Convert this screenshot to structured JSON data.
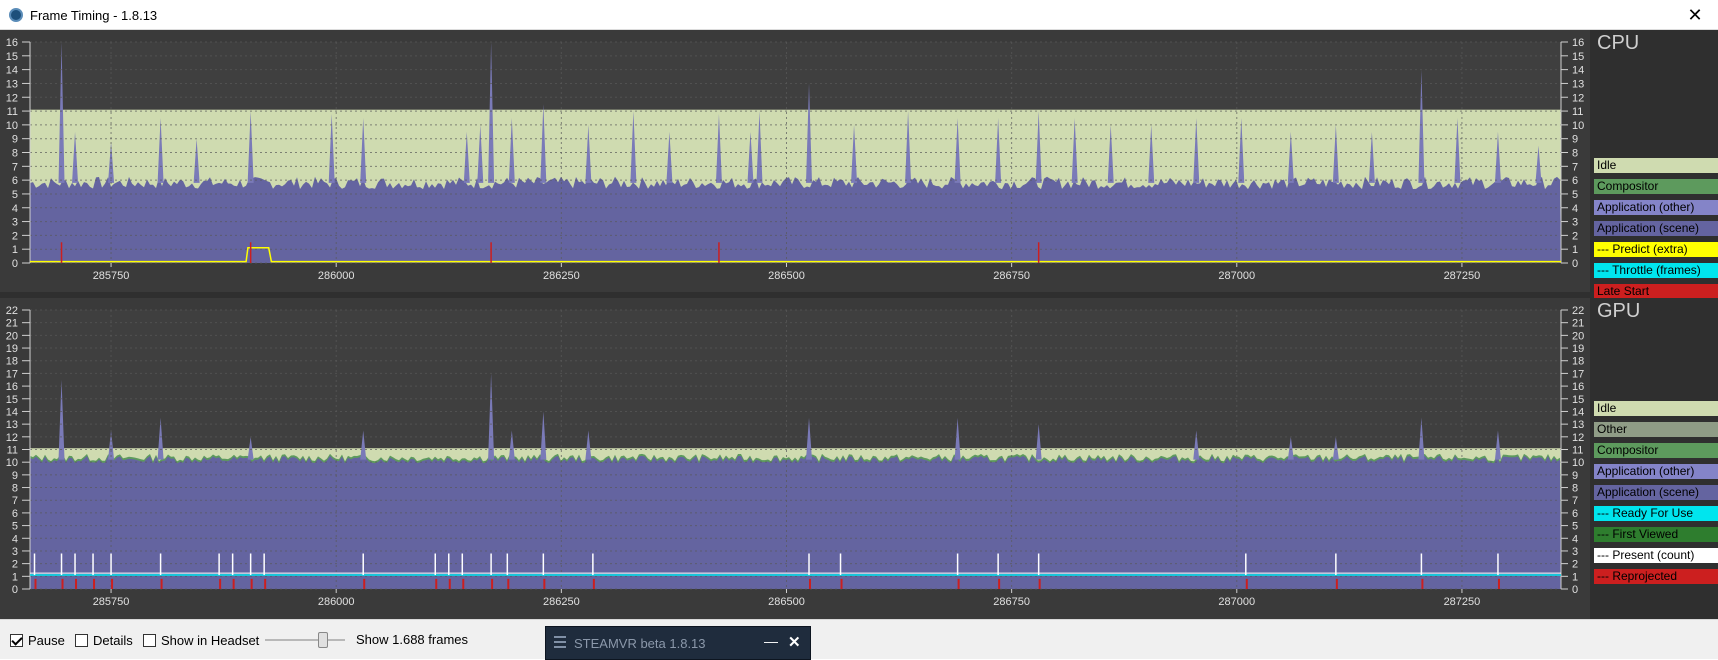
{
  "window": {
    "title": "Frame Timing - 1.8.13",
    "close_glyph": "✕"
  },
  "icons": {
    "app": "steamvr-logo-icon",
    "close": "close-icon"
  },
  "cpu": {
    "title": "CPU",
    "legend": [
      {
        "label": "Idle",
        "color": "#cfdbb0"
      },
      {
        "label": "Compositor",
        "color": "#5d9a5d"
      },
      {
        "label": "Application (other)",
        "color": "#8484c8"
      },
      {
        "label": "Application (scene)",
        "color": "#6464a0"
      },
      {
        "label": "--- Predict (extra)",
        "color": "#ffff00"
      },
      {
        "label": "--- Throttle (frames)",
        "color": "#00e5ee"
      },
      {
        "label": "Late Start",
        "color": "#cc1f1f"
      }
    ]
  },
  "gpu": {
    "title": "GPU",
    "legend": [
      {
        "label": "Idle",
        "color": "#cfdbb0"
      },
      {
        "label": "Other",
        "color": "#8f9c86"
      },
      {
        "label": "Compositor",
        "color": "#5d9a5d"
      },
      {
        "label": "Application (other)",
        "color": "#8484c8"
      },
      {
        "label": "Application (scene)",
        "color": "#6464a0"
      },
      {
        "label": "--- Ready For Use",
        "color": "#00e5ee"
      },
      {
        "label": "--- First Viewed",
        "color": "#2e7d2e"
      },
      {
        "label": "--- Present (count)",
        "color": "#ffffff"
      },
      {
        "label": "--- Reprojected",
        "color": "#cc1f1f"
      }
    ]
  },
  "chart_data": [
    {
      "type": "area",
      "title": "CPU",
      "x_ticks": [
        "285750",
        "286000",
        "286250",
        "286500",
        "286750",
        "287000",
        "287250"
      ],
      "xlim": [
        285660,
        287360
      ],
      "ylim": [
        0,
        16
      ],
      "y_ticks": [
        0,
        1,
        2,
        3,
        4,
        5,
        6,
        7,
        8,
        9,
        10,
        11,
        12,
        13,
        14,
        15,
        16
      ],
      "grid": true,
      "frame_budget_ms": 11.1,
      "series": [
        {
          "name": "Idle",
          "baseline_ms": 11.1
        },
        {
          "name": "Application (scene)",
          "baseline_ms": 5.8
        },
        {
          "name": "--- Predict (extra)",
          "values": [
            [
              285660,
              0.1
            ],
            [
              285900,
              0.1
            ],
            [
              285902,
              1.1
            ],
            [
              285925,
              1.1
            ],
            [
              285928,
              0.1
            ],
            [
              287360,
              0.1
            ]
          ]
        }
      ],
      "spikes_ms": [
        [
          285695,
          16
        ],
        [
          285710,
          9.5
        ],
        [
          285750,
          8.8
        ],
        [
          285805,
          10.5
        ],
        [
          285845,
          9
        ],
        [
          285905,
          11
        ],
        [
          285995,
          10.8
        ],
        [
          286030,
          10.5
        ],
        [
          286145,
          9.5
        ],
        [
          286160,
          10
        ],
        [
          286172,
          16
        ],
        [
          286195,
          10.5
        ],
        [
          286230,
          11.5
        ],
        [
          286280,
          10
        ],
        [
          286330,
          11
        ],
        [
          286370,
          9.5
        ],
        [
          286425,
          10.8
        ],
        [
          286460,
          9.5
        ],
        [
          286470,
          11
        ],
        [
          286525,
          13
        ],
        [
          286575,
          10
        ],
        [
          286635,
          11
        ],
        [
          286690,
          10.5
        ],
        [
          286735,
          10.5
        ],
        [
          286780,
          11
        ],
        [
          286820,
          10.5
        ],
        [
          286860,
          10
        ],
        [
          286905,
          10
        ],
        [
          286955,
          10.5
        ],
        [
          287005,
          10.5
        ],
        [
          287060,
          9.5
        ],
        [
          287110,
          10
        ],
        [
          287150,
          9.5
        ],
        [
          287205,
          14
        ],
        [
          287245,
          10.5
        ],
        [
          287290,
          9.5
        ],
        [
          287335,
          8.5
        ]
      ]
    },
    {
      "type": "area",
      "title": "GPU",
      "x_ticks": [
        "285750",
        "286000",
        "286250",
        "286500",
        "286750",
        "287000",
        "287250"
      ],
      "xlim": [
        285660,
        287360
      ],
      "ylim": [
        0,
        22
      ],
      "y_ticks": [
        0,
        1,
        2,
        3,
        4,
        5,
        6,
        7,
        8,
        9,
        10,
        11,
        12,
        13,
        14,
        15,
        16,
        17,
        18,
        19,
        20,
        21,
        22
      ],
      "grid": true,
      "frame_budget_ms": 11.1,
      "series": [
        {
          "name": "Idle",
          "baseline_ms": 11.1
        },
        {
          "name": "Application (scene)",
          "baseline_ms": 10.2
        },
        {
          "name": "--- Ready For Use",
          "baseline_ms": 1.1
        },
        {
          "name": "--- Present (count)",
          "baseline_ms": 1.2
        }
      ],
      "spikes_ms": [
        [
          285695,
          16.5
        ],
        [
          285750,
          12.5
        ],
        [
          285805,
          13.5
        ],
        [
          285905,
          12
        ],
        [
          286030,
          12.5
        ],
        [
          286172,
          17
        ],
        [
          286195,
          12.5
        ],
        [
          286230,
          14
        ],
        [
          286280,
          12.5
        ],
        [
          286525,
          13.5
        ],
        [
          286690,
          13.5
        ],
        [
          286780,
          13
        ],
        [
          286955,
          12.5
        ],
        [
          287060,
          12
        ],
        [
          287110,
          12
        ],
        [
          287205,
          13.5
        ],
        [
          287290,
          12.5
        ]
      ],
      "present_markers_x": [
        285665,
        285695,
        285710,
        285730,
        285750,
        285805,
        285870,
        285885,
        285905,
        285920,
        286030,
        286110,
        286125,
        286140,
        286172,
        286190,
        286230,
        286285,
        286525,
        286560,
        286690,
        286735,
        286780,
        287010,
        287110,
        287205,
        287290
      ]
    }
  ],
  "bottombar": {
    "pause": {
      "label": "Pause",
      "checked": true
    },
    "details": {
      "label": "Details",
      "checked": false
    },
    "show_in_headset": {
      "label": "Show in Headset",
      "checked": false
    },
    "slider_fraction": 0.75,
    "frames_label": "Show 1.688 frames"
  },
  "taskbar": {
    "label": "STEAMVR beta 1.8.13",
    "minimize_glyph": "—",
    "close_glyph": "✕",
    "menu_icon": "hamburger-menu-icon"
  }
}
